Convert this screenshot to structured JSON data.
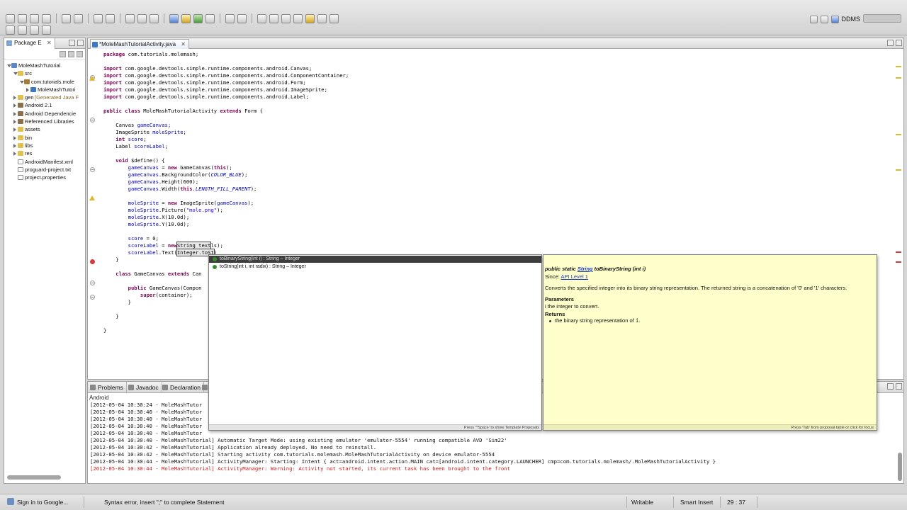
{
  "toolbar": {
    "perspective_label": "DDMS"
  },
  "package_explorer": {
    "tab_label": "Package E",
    "tab_close": "✕",
    "tree": [
      {
        "label": "MoleMashTutorial",
        "indent": 0,
        "expanded": true,
        "icon": "project-icon"
      },
      {
        "label": "src",
        "indent": 1,
        "expanded": true,
        "icon": "folder-icon"
      },
      {
        "label": "com.tutorials.mole",
        "indent": 2,
        "expanded": true,
        "icon": "package-icon"
      },
      {
        "label": "MoleMashTutori",
        "indent": 3,
        "expanded": false,
        "icon": "java-file-icon"
      },
      {
        "label": "gen",
        "suffix": "[Generated Java F",
        "indent": 1,
        "expanded": false,
        "icon": "folder-icon"
      },
      {
        "label": "Android 2.1",
        "indent": 1,
        "expanded": false,
        "icon": "library-icon"
      },
      {
        "label": "Android Dependencie",
        "indent": 1,
        "expanded": false,
        "icon": "library-icon"
      },
      {
        "label": "Referenced Libraries",
        "indent": 1,
        "expanded": false,
        "icon": "library-icon"
      },
      {
        "label": "assets",
        "indent": 1,
        "expanded": false,
        "icon": "folder-icon"
      },
      {
        "label": "bin",
        "indent": 1,
        "expanded": false,
        "icon": "folder-icon"
      },
      {
        "label": "libs",
        "indent": 1,
        "expanded": false,
        "icon": "folder-icon"
      },
      {
        "label": "res",
        "indent": 1,
        "expanded": false,
        "icon": "folder-icon"
      },
      {
        "label": "AndroidManifest.xml",
        "indent": 1,
        "leaf": true,
        "icon": "file-icon"
      },
      {
        "label": "proguard-project.txt",
        "indent": 1,
        "leaf": true,
        "icon": "file-icon"
      },
      {
        "label": "project.properties",
        "indent": 1,
        "leaf": true,
        "icon": "file-icon"
      }
    ]
  },
  "editor": {
    "tab_label": "*MoleMashTutorialActivity.java",
    "tab_close": "✕",
    "lines": [
      {
        "t": [
          [
            "package ",
            "kw"
          ],
          [
            "com.tutorials.molemash;",
            ""
          ]
        ]
      },
      {
        "t": []
      },
      {
        "t": [
          [
            "import ",
            "kw"
          ],
          [
            "com.google.devtools.simple.runtime.components.android.Canvas;",
            ""
          ]
        ]
      },
      {
        "t": [
          [
            "import ",
            "kw"
          ],
          [
            "com.google.devtools.simple.runtime.components.android.ComponentContainer;",
            ""
          ]
        ]
      },
      {
        "t": [
          [
            "import ",
            "kw"
          ],
          [
            "com.google.devtools.simple.runtime.components.android.Form;",
            ""
          ]
        ]
      },
      {
        "t": [
          [
            "import ",
            "kw"
          ],
          [
            "com.google.devtools.simple.runtime.components.android.ImageSprite;",
            ""
          ]
        ]
      },
      {
        "t": [
          [
            "import ",
            "kw"
          ],
          [
            "com.google.devtools.simple.runtime.components.android.Label;",
            ""
          ]
        ]
      },
      {
        "t": []
      },
      {
        "t": [
          [
            "public class ",
            "kw"
          ],
          [
            "MoleMashTutorialActivity ",
            ""
          ],
          [
            "extends ",
            "kw"
          ],
          [
            "Form {",
            ""
          ]
        ]
      },
      {
        "t": []
      },
      {
        "t": [
          [
            "    Canvas ",
            ""
          ],
          [
            "gameCanvas",
            "fld"
          ],
          [
            ";",
            ""
          ]
        ]
      },
      {
        "t": [
          [
            "    ImageSprite ",
            ""
          ],
          [
            "moleSprite",
            "fld"
          ],
          [
            ";",
            ""
          ]
        ]
      },
      {
        "t": [
          [
            "    int ",
            "kw"
          ],
          [
            "score",
            "fld"
          ],
          [
            ";",
            ""
          ]
        ]
      },
      {
        "t": [
          [
            "    Label ",
            ""
          ],
          [
            "scoreLabel",
            "fld"
          ],
          [
            ";",
            ""
          ]
        ]
      },
      {
        "t": []
      },
      {
        "t": [
          [
            "    void ",
            "kw"
          ],
          [
            "$define() {",
            ""
          ]
        ]
      },
      {
        "t": [
          [
            "        gameCanvas",
            "fld"
          ],
          [
            " = ",
            ""
          ],
          [
            "new ",
            "kw"
          ],
          [
            "GameCanvas(",
            ""
          ],
          [
            "this",
            "kw"
          ],
          [
            ");",
            ""
          ]
        ]
      },
      {
        "t": [
          [
            "        gameCanvas",
            "fld"
          ],
          [
            ".BackgroundColor(",
            ""
          ],
          [
            "COLOR_BLUE",
            "fld ital"
          ],
          [
            ");",
            ""
          ]
        ]
      },
      {
        "t": [
          [
            "        gameCanvas",
            "fld"
          ],
          [
            ".Height(600);",
            ""
          ]
        ]
      },
      {
        "t": [
          [
            "        gameCanvas",
            "fld"
          ],
          [
            ".Width(",
            ""
          ],
          [
            "this",
            "kw"
          ],
          [
            ".",
            ""
          ],
          [
            "LENGTH_FILL_PARENT",
            "fld ital"
          ],
          [
            ");",
            ""
          ]
        ]
      },
      {
        "t": []
      },
      {
        "t": [
          [
            "        moleSprite",
            "fld"
          ],
          [
            " = ",
            ""
          ],
          [
            "new ",
            "kw"
          ],
          [
            "ImageSprite(",
            ""
          ],
          [
            "gameCanvas",
            "fld"
          ],
          [
            ");",
            ""
          ]
        ]
      },
      {
        "t": [
          [
            "        moleSprite",
            "fld"
          ],
          [
            ".Picture(",
            ""
          ],
          [
            "\"mole.png\"",
            "str"
          ],
          [
            ");",
            ""
          ]
        ]
      },
      {
        "t": [
          [
            "        moleSprite",
            "fld"
          ],
          [
            ".X(10.0d);",
            ""
          ]
        ]
      },
      {
        "t": [
          [
            "        moleSprite",
            "fld"
          ],
          [
            ".Y(10.0d);",
            ""
          ]
        ]
      },
      {
        "t": []
      },
      {
        "t": [
          [
            "        score",
            "fld"
          ],
          [
            " = 0;",
            ""
          ]
        ]
      },
      {
        "t": [
          [
            "        scoreLabel",
            "fld"
          ],
          [
            " = ",
            ""
          ],
          [
            "new",
            "kw"
          ],
          [
            "String text",
            "cursor-box"
          ],
          [
            "ls);",
            ""
          ]
        ]
      },
      {
        "t": [
          [
            "        scoreLabel",
            "fld"
          ],
          [
            ".Text(",
            ""
          ],
          [
            "Integer.toSt",
            "cursor-box"
          ],
          [
            ")",
            ""
          ]
        ]
      },
      {
        "t": [
          [
            "    }",
            ""
          ]
        ]
      },
      {
        "t": []
      },
      {
        "t": [
          [
            "    class ",
            "kw"
          ],
          [
            "GameCanvas ",
            ""
          ],
          [
            "extends ",
            "kw"
          ],
          [
            "Can",
            ""
          ]
        ]
      },
      {
        "t": []
      },
      {
        "t": [
          [
            "        public ",
            "kw"
          ],
          [
            "GameCanvas(Compon",
            ""
          ]
        ]
      },
      {
        "t": [
          [
            "            super",
            "kw"
          ],
          [
            "(container);",
            ""
          ]
        ]
      },
      {
        "t": [
          [
            "        }",
            ""
          ]
        ]
      },
      {
        "t": []
      },
      {
        "t": [
          [
            "    }",
            ""
          ]
        ]
      },
      {
        "t": []
      },
      {
        "t": [
          [
            "}",
            ""
          ]
        ]
      }
    ]
  },
  "content_assist": {
    "items": [
      {
        "label": "toBinaryString(int i) : String – Integer",
        "selected": true
      },
      {
        "label": "toString(int i, int radix) : String – Integer",
        "selected": false
      }
    ],
    "status": "Press '^Space' to show Template Proposals"
  },
  "javadoc": {
    "signature_prefix": "public static ",
    "signature_type": "String",
    "signature_rest": " toBinaryString (int i)",
    "since_label": "Since: ",
    "since_link": "API Level 1",
    "description": "Converts the specified integer into its binary string representation. The returned string is a concatenation of '0' and '1' characters.",
    "params_heading": "Parameters",
    "param_name": "i",
    "param_desc": " the integer to convert.",
    "returns_heading": "Returns",
    "returns_desc": "the binary string representation of ",
    "returns_var": "i",
    "returns_end": ".",
    "status": "Press 'Tab' from proposal table or click for focus"
  },
  "console": {
    "tabs": [
      "Problems",
      "Javadoc",
      "Declaration"
    ],
    "title": "Android",
    "lines": [
      {
        "text": "[2012-05-04 10:30:24 - MoleMashTutor",
        "red": false
      },
      {
        "text": "[2012-05-04 10:30:40 - MoleMashTutor",
        "red": false
      },
      {
        "text": "[2012-05-04 10:30:40 - MoleMashTutor",
        "red": false
      },
      {
        "text": "[2012-05-04 10:30:40 - MoleMashTutor",
        "red": false
      },
      {
        "text": "[2012-05-04 10:30:40 - MoleMashTutor",
        "red": false
      },
      {
        "text": "[2012-05-04 10:30:40 - MoleMashTutorial] Automatic Target Mode: using existing emulator 'emulator-5554' running compatible AVD 'Sim22'",
        "red": false
      },
      {
        "text": "[2012-05-04 10:30:42 - MoleMashTutorial] Application already deployed. No need to reinstall.",
        "red": false
      },
      {
        "text": "[2012-05-04 10:30:42 - MoleMashTutorial] Starting activity com.tutorials.molemash.MoleMashTutorialActivity on device emulator-5554",
        "red": false
      },
      {
        "text": "[2012-05-04 10:30:44 - MoleMashTutorial] ActivityManager: Starting: Intent { act=android.intent.action.MAIN cat=[android.intent.category.LAUNCHER] cmp=com.tutorials.molemash/.MoleMashTutorialActivity }",
        "red": false
      },
      {
        "text": "[2012-05-04 10:30:44 - MoleMashTutorial] ActivityManager: Warning: Activity not started, its current task has been brought to the front",
        "red": true
      }
    ]
  },
  "statusbar": {
    "signin": "Sign in to Google...",
    "message": "Syntax error, insert \";\" to complete Statement",
    "writable": "Writable",
    "insert_mode": "Smart Insert",
    "position": "29 : 37"
  }
}
